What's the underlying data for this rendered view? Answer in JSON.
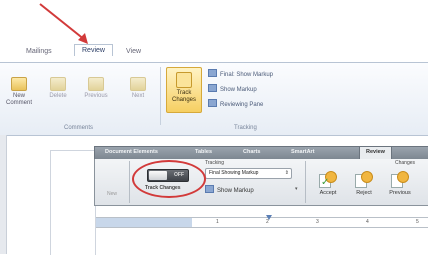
{
  "upper_ribbon": {
    "tabs": [
      "Mailings",
      "Review",
      "View"
    ],
    "buttons": [
      "New Comment",
      "Delete",
      "Previous",
      "Next"
    ],
    "track_button": "Track Changes",
    "track_small": [
      "Final: Show Markup",
      "Show Markup",
      "Reviewing Pane"
    ],
    "groups": [
      "Comments",
      "Tracking"
    ]
  },
  "lower_ribbon": {
    "tabs": [
      "Document Elements",
      "Tables",
      "Charts",
      "SmartArt",
      "Review"
    ],
    "tracking_label": "Tracking",
    "track_switch_label": "Track Changes",
    "switch_state": "OFF",
    "final_display": "Final Showing Markup",
    "show_markup": "Show Markup",
    "group_right_label": "Changes",
    "buttons": [
      "Accept",
      "Reject",
      "Previous"
    ],
    "left_label": "New"
  },
  "ruler": {
    "numbers": [
      "1",
      "2",
      "3",
      "4",
      "5"
    ]
  },
  "colors": {
    "annotation": "#d23a3a",
    "accent": "#f1b640"
  }
}
